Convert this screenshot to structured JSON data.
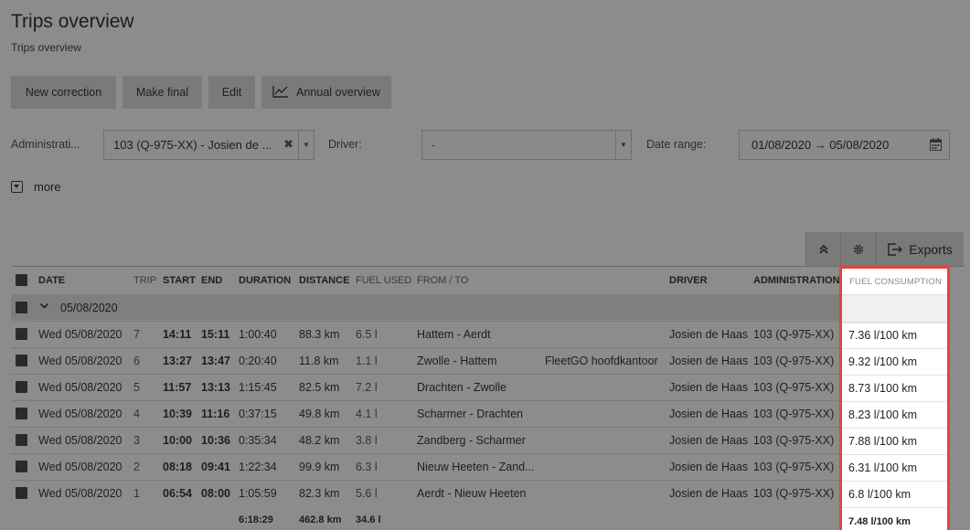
{
  "page": {
    "title": "Trips overview",
    "subtitle": "Trips overview"
  },
  "toolbar": {
    "new_correction": "New correction",
    "make_final": "Make final",
    "edit": "Edit",
    "annual_overview": "Annual overview"
  },
  "filters": {
    "administration_label": "Administrati...",
    "administration_value": "103 (Q-975-XX) - Josien de ...",
    "driver_label": "Driver:",
    "driver_value": "-",
    "date_label": "Date range:",
    "date_value": "01/08/2020 → 05/08/2020",
    "more": "more"
  },
  "table_actions": {
    "exports": "Exports"
  },
  "table": {
    "headers": {
      "date": "DATE",
      "trip": "TRIP",
      "start": "START",
      "end": "END",
      "duration": "DURATION",
      "distance": "DISTANCE",
      "fuel_used": "FUEL USED",
      "from_to": "FROM / TO",
      "driver": "DRIVER",
      "administration": "ADMINISTRATION",
      "fuel_consumption": "FUEL CONSUMPTION"
    },
    "group": "05/08/2020",
    "rows": [
      {
        "date": "Wed 05/08/2020",
        "trip": "7",
        "start": "14:11",
        "end": "15:11",
        "duration": "1:00:40",
        "distance": "88.3 km",
        "fuel": "6.5 l",
        "route": "Hattem - Aerdt",
        "location": "",
        "driver": "Josien de Haas",
        "admin": "103 (Q-975-XX)",
        "consumption": "7.36 l/100 km"
      },
      {
        "date": "Wed 05/08/2020",
        "trip": "6",
        "start": "13:27",
        "end": "13:47",
        "duration": "0:20:40",
        "distance": "11.8 km",
        "fuel": "1.1 l",
        "route": "Zwolle - Hattem",
        "location": "FleetGO hoofdkantoor",
        "driver": "Josien de Haas",
        "admin": "103 (Q-975-XX)",
        "consumption": "9.32 l/100 km"
      },
      {
        "date": "Wed 05/08/2020",
        "trip": "5",
        "start": "11:57",
        "end": "13:13",
        "duration": "1:15:45",
        "distance": "82.5 km",
        "fuel": "7.2 l",
        "route": "Drachten - Zwolle",
        "location": "",
        "driver": "Josien de Haas",
        "admin": "103 (Q-975-XX)",
        "consumption": "8.73 l/100 km"
      },
      {
        "date": "Wed 05/08/2020",
        "trip": "4",
        "start": "10:39",
        "end": "11:16",
        "duration": "0:37:15",
        "distance": "49.8 km",
        "fuel": "4.1 l",
        "route": "Scharmer - Drachten",
        "location": "",
        "driver": "Josien de Haas",
        "admin": "103 (Q-975-XX)",
        "consumption": "8.23 l/100 km"
      },
      {
        "date": "Wed 05/08/2020",
        "trip": "3",
        "start": "10:00",
        "end": "10:36",
        "duration": "0:35:34",
        "distance": "48.2 km",
        "fuel": "3.8 l",
        "route": "Zandberg - Scharmer",
        "location": "",
        "driver": "Josien de Haas",
        "admin": "103 (Q-975-XX)",
        "consumption": "7.88 l/100 km"
      },
      {
        "date": "Wed 05/08/2020",
        "trip": "2",
        "start": "08:18",
        "end": "09:41",
        "duration": "1:22:34",
        "distance": "99.9 km",
        "fuel": "6.3 l",
        "route": "Nieuw Heeten - Zand...",
        "location": "",
        "driver": "Josien de Haas",
        "admin": "103 (Q-975-XX)",
        "consumption": "6.31 l/100 km"
      },
      {
        "date": "Wed 05/08/2020",
        "trip": "1",
        "start": "06:54",
        "end": "08:00",
        "duration": "1:05:59",
        "distance": "82.3 km",
        "fuel": "5.6 l",
        "route": "Aerdt - Nieuw Heeten",
        "location": "",
        "driver": "Josien de Haas",
        "admin": "103 (Q-975-XX)",
        "consumption": "6.8 l/100 km"
      }
    ],
    "totals": {
      "duration": "6:18:29",
      "distance": "462.8 km",
      "fuel": "34.6 l",
      "consumption": "7.48 l/100 km"
    }
  },
  "colors": {
    "highlight_border": "#e2453a",
    "overlay": "#8c8c8c"
  }
}
